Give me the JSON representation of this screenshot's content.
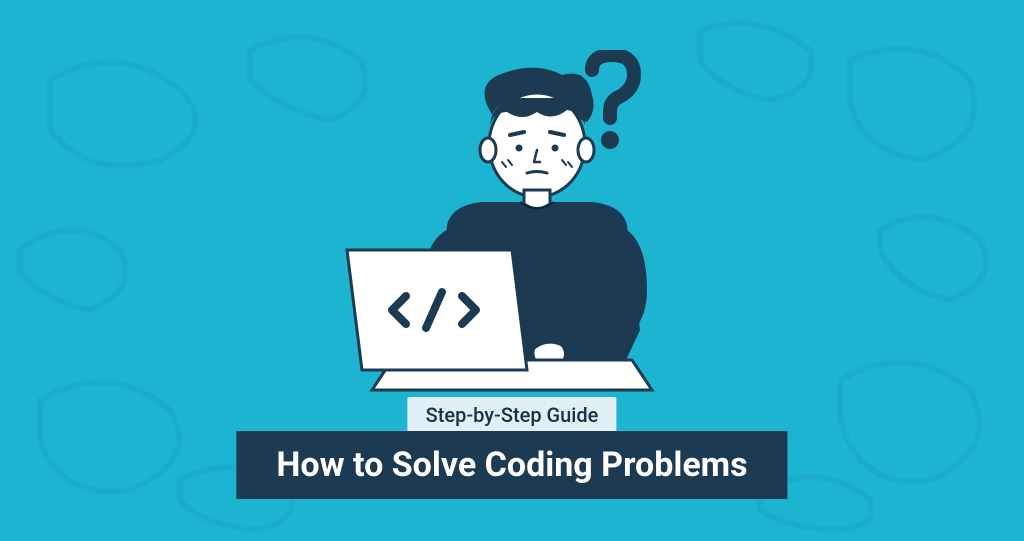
{
  "subtitle": "Step-by-Step Guide",
  "title": "How to Solve Coding Problems",
  "colors": {
    "background": "#1DB4D1",
    "dark": "#1C3A52",
    "light": "#E0F0F4",
    "white": "#FFFFFF"
  }
}
